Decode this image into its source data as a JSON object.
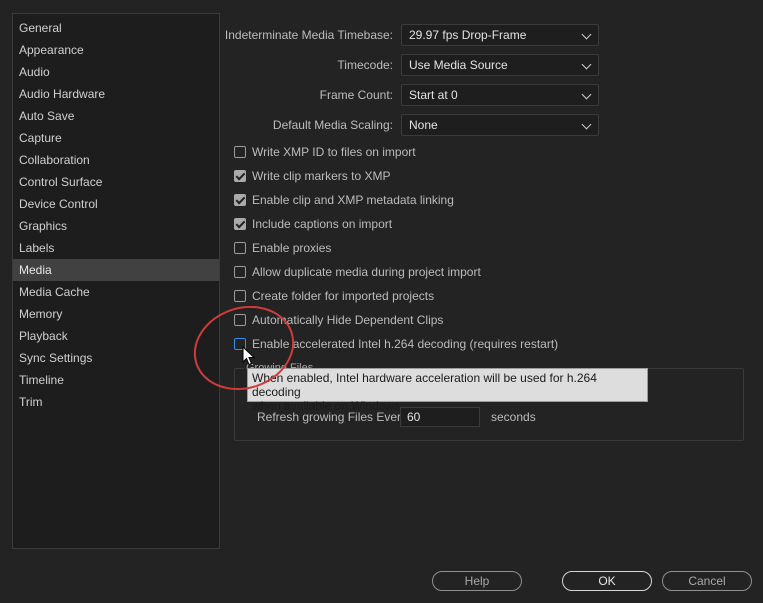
{
  "sidebar": {
    "items": [
      {
        "label": "General"
      },
      {
        "label": "Appearance"
      },
      {
        "label": "Audio"
      },
      {
        "label": "Audio Hardware"
      },
      {
        "label": "Auto Save"
      },
      {
        "label": "Capture"
      },
      {
        "label": "Collaboration"
      },
      {
        "label": "Control Surface"
      },
      {
        "label": "Device Control"
      },
      {
        "label": "Graphics"
      },
      {
        "label": "Labels"
      },
      {
        "label": "Media"
      },
      {
        "label": "Media Cache"
      },
      {
        "label": "Memory"
      },
      {
        "label": "Playback"
      },
      {
        "label": "Sync Settings"
      },
      {
        "label": "Timeline"
      },
      {
        "label": "Trim"
      }
    ],
    "selected": "Media"
  },
  "settings": {
    "timebase": {
      "label": "Indeterminate Media Timebase:",
      "value": "29.97 fps Drop-Frame"
    },
    "timecode": {
      "label": "Timecode:",
      "value": "Use Media Source"
    },
    "frame_count": {
      "label": "Frame Count:",
      "value": "Start at 0"
    },
    "scaling": {
      "label": "Default Media Scaling:",
      "value": "None"
    }
  },
  "checkboxes": [
    {
      "label": "Write XMP ID to files on import",
      "checked": false
    },
    {
      "label": "Write clip markers to XMP",
      "checked": true
    },
    {
      "label": "Enable clip and XMP metadata linking",
      "checked": true
    },
    {
      "label": "Include captions on import",
      "checked": true
    },
    {
      "label": "Enable proxies",
      "checked": false
    },
    {
      "label": "Allow duplicate media during project import",
      "checked": false
    },
    {
      "label": "Create folder for imported projects",
      "checked": false
    },
    {
      "label": "Automatically Hide Dependent Clips",
      "checked": false
    },
    {
      "label": "Enable accelerated Intel h.264 decoding (requires restart)",
      "checked": false
    }
  ],
  "growing_files": {
    "title": "Growing Files",
    "refresh_label": "Refresh growing Files Every",
    "refresh_value": "60",
    "seconds_label": "seconds"
  },
  "tooltip": {
    "line1": "When enabled, Intel hardware acceleration will be used for h.264 decoding",
    "line2": "when available on Windows"
  },
  "buttons": {
    "help": "Help",
    "ok": "OK",
    "cancel": "Cancel"
  },
  "colors": {
    "accent_focus": "#3a8ee6",
    "annotation_circle": "#d23b3b",
    "selected_row": "#414141"
  }
}
